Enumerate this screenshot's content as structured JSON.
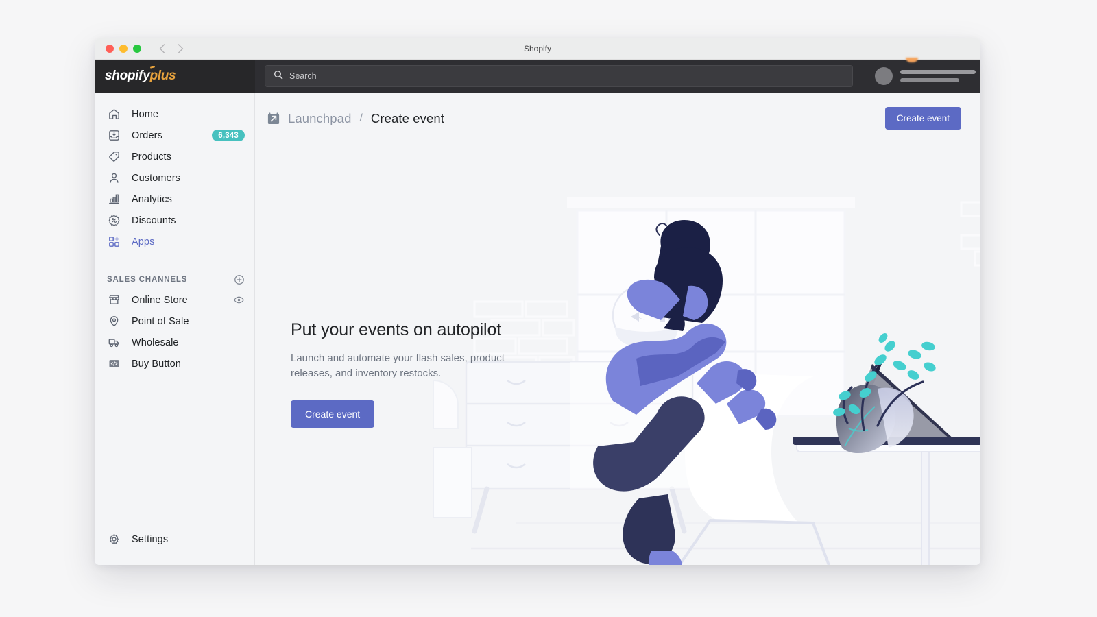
{
  "window": {
    "title": "Shopify",
    "traffic_lights": [
      "close",
      "minimize",
      "maximize"
    ],
    "back_label": "Back",
    "forward_label": "Forward"
  },
  "topbar": {
    "logo_word": "shopify",
    "logo_plus": "plus",
    "search": {
      "placeholder": "Search",
      "value": "",
      "icon": "search-icon"
    },
    "account": {
      "avatar_redacted": true,
      "name_redacted": true,
      "store_redacted": true
    }
  },
  "sidebar": {
    "items": [
      {
        "label": "Home",
        "icon": "home-icon",
        "active": false,
        "badge": ""
      },
      {
        "label": "Orders",
        "icon": "orders-inbox-icon",
        "active": false,
        "badge": "6,343"
      },
      {
        "label": "Products",
        "icon": "tag-icon",
        "active": false,
        "badge": ""
      },
      {
        "label": "Customers",
        "icon": "person-icon",
        "active": false,
        "badge": ""
      },
      {
        "label": "Analytics",
        "icon": "bar-chart-icon",
        "active": false,
        "badge": ""
      },
      {
        "label": "Discounts",
        "icon": "percent-badge-icon",
        "active": false,
        "badge": ""
      },
      {
        "label": "Apps",
        "icon": "apps-grid-plus-icon",
        "active": true,
        "badge": ""
      }
    ],
    "sales_channels": {
      "title": "SALES CHANNELS",
      "add_icon": "plus-circle-icon",
      "items": [
        {
          "label": "Online Store",
          "icon": "storefront-icon",
          "trailing_icon": "eye-icon"
        },
        {
          "label": "Point of Sale",
          "icon": "map-pin-icon",
          "trailing_icon": ""
        },
        {
          "label": "Wholesale",
          "icon": "truck-icon",
          "trailing_icon": ""
        },
        {
          "label": "Buy Button",
          "icon": "code-brackets-icon",
          "trailing_icon": ""
        }
      ]
    },
    "settings": {
      "label": "Settings",
      "icon": "gear-icon"
    }
  },
  "main": {
    "breadcrumb": {
      "icon": "launchpad-calendar-arrow-icon",
      "parent": "Launchpad",
      "separator": "/",
      "current": "Create event"
    },
    "header_button": "Create event",
    "empty_state": {
      "heading": "Put your events on autopilot",
      "description": "Launch and automate your flash sales, product releases, and inventory restocks.",
      "button": "Create event",
      "illustration": "person-at-desk-with-laptop-plant-dresser"
    }
  },
  "colors": {
    "accent_indigo": "#5c6ac4",
    "badge_teal": "#47c1bf",
    "logo_gold": "#e8a33d",
    "topbar_dark": "#2e2e32",
    "surface": "#f4f5f7",
    "text_primary": "#1f2225",
    "text_muted": "#6d7480",
    "illustration_navy": "#1f2551",
    "illustration_periwinkle": "#7b84da",
    "illustration_teal": "#45cfcf"
  }
}
